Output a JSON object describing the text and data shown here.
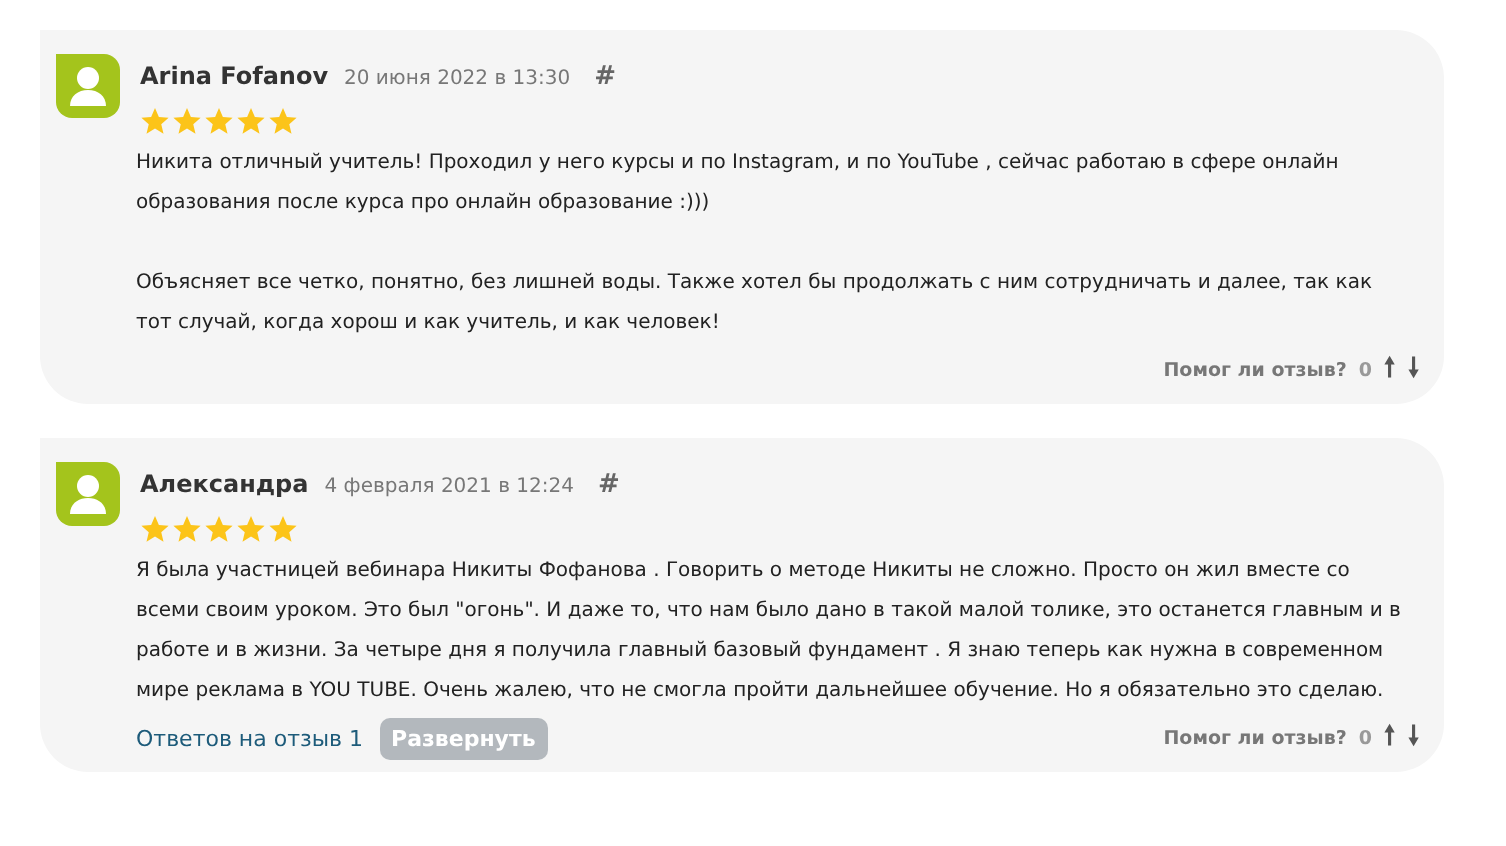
{
  "reviews": [
    {
      "author": "Arina Fofanov",
      "date": "20 июня 2022 в 13:30",
      "anchor": "#",
      "stars": 5,
      "paragraphs": [
        "Никита отличный учитель! Проходил у него курсы и по Instagram, и по YouTube , сейчас работаю в сфере онлайн образования после курса про онлайн образование :)))",
        "Объясняет все четко, понятно, без лишней воды. Также хотел бы продолжать с ним сотрудничать и далее, так как тот случай, когда хорош и как учитель, и как человек!"
      ],
      "helpful_label": "Помог ли отзыв?",
      "helpful_count": "0",
      "up": "🠕",
      "down": "🠗"
    },
    {
      "author": "Александра",
      "date": "4 февраля 2021 в 12:24",
      "anchor": "#",
      "stars": 5,
      "paragraphs": [
        "Я была участницей вебинара Никиты Фофанова . Говорить о методе Никиты не сложно. Просто он жил вместе со всеми своим уроком. Это был \"огонь\". И даже то, что нам было дано в такой малой толике, это останется главным и в работе и в жизни. За четыре дня я получила главный базовый фундамент . Я знаю теперь как нужна в современном мире реклама в YOU TUBE. Очень жалею, что не смогла пройти дальнейшее обучение. Но я обязательно это сделаю."
      ],
      "replies_link": "Ответов на отзыв 1",
      "expand_button": "Развернуть",
      "helpful_label": "Помог ли отзыв?",
      "helpful_count": "0",
      "up": "🠕",
      "down": "🠗"
    }
  ]
}
